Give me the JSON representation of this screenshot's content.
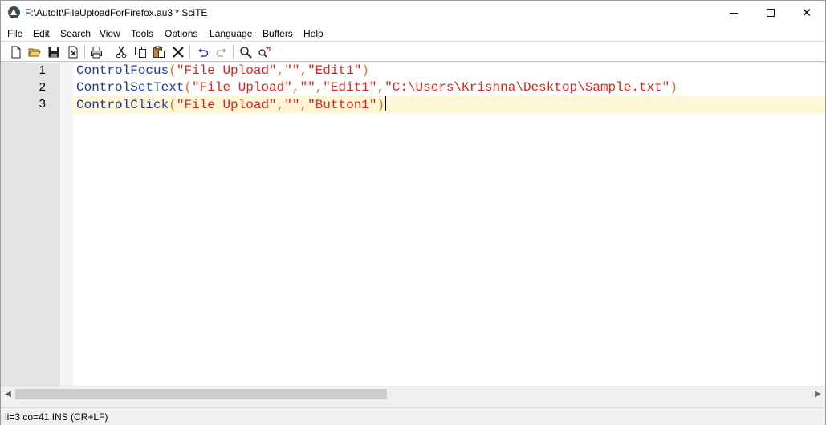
{
  "window": {
    "title": "F:\\AutoIt\\FileUploadForFirefox.au3 * SciTE",
    "minimize_glyph": "",
    "close_glyph": "✕"
  },
  "menu": {
    "items": [
      {
        "label": "File"
      },
      {
        "label": "Edit"
      },
      {
        "label": "Search"
      },
      {
        "label": "View"
      },
      {
        "label": "Tools"
      },
      {
        "label": "Options"
      },
      {
        "label": "Language"
      },
      {
        "label": "Buffers"
      },
      {
        "label": "Help"
      }
    ]
  },
  "toolbar": {
    "buttons": [
      "new-file-icon",
      "open-folder-icon",
      "save-icon",
      "close-file-icon",
      "print-icon",
      "cut-icon",
      "copy-icon",
      "paste-icon",
      "delete-icon",
      "undo-icon",
      "redo-icon",
      "find-icon",
      "replace-icon"
    ]
  },
  "editor": {
    "lines": [
      {
        "num": "1",
        "fn": "ControlFocus",
        "open": "(",
        "args": [
          "\"File Upload\"",
          "\"\"",
          "\"Edit1\""
        ],
        "close": ")"
      },
      {
        "num": "2",
        "fn": "ControlSetText",
        "open": "(",
        "args": [
          "\"File Upload\"",
          "\"\"",
          "\"Edit1\"",
          "\"C:\\Users\\Krishna\\Desktop\\Sample.txt\""
        ],
        "close": ")"
      },
      {
        "num": "3",
        "fn": "ControlClick",
        "open": "(",
        "args": [
          "\"File Upload\"",
          "\"\"",
          "\"Button1\""
        ],
        "close": ")"
      }
    ],
    "current_line": 3,
    "colors": {
      "function": "#1f3b8f",
      "operator": "#e2702a",
      "string": "#e0221c",
      "current_line_bg": "#fff6d5"
    }
  },
  "scrollbar": {
    "left_arrow": "◀",
    "right_arrow": "▶"
  },
  "status": {
    "text": "li=3 co=41 INS (CR+LF)"
  }
}
